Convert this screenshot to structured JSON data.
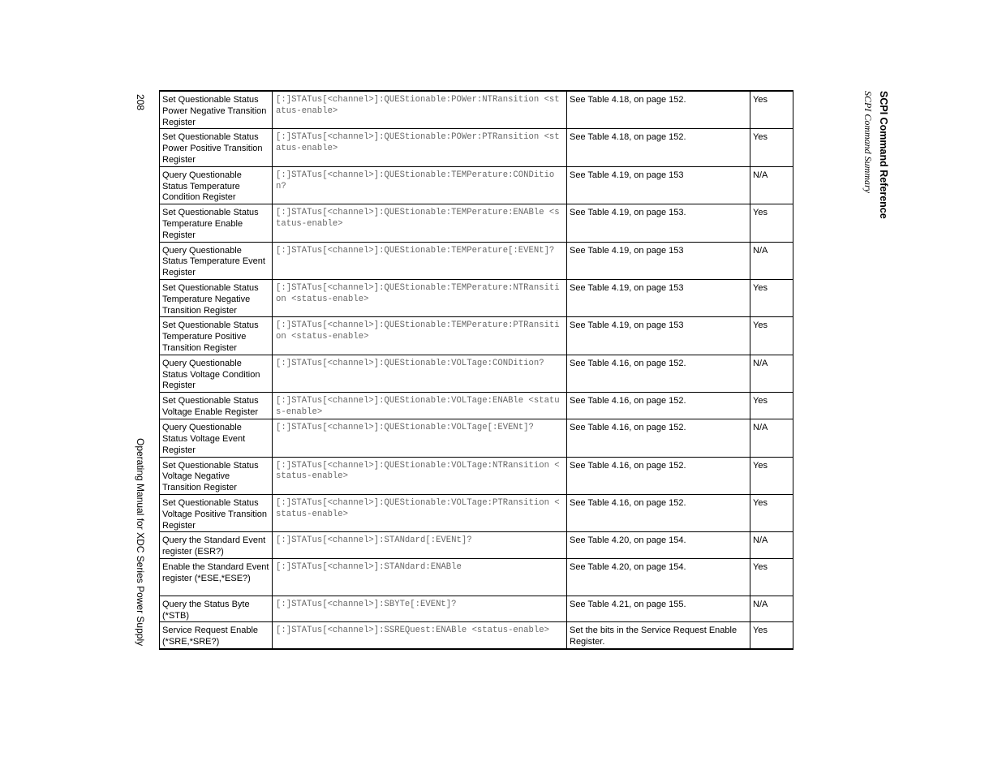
{
  "page_number": "208",
  "footer": "Operating Manual for XDC Series Power Supply",
  "header": {
    "title": "SCPI Command Reference",
    "subtitle": "SCPI Command Summary"
  },
  "rows": [
    {
      "function": "Set Questionable Status Power Negative Transition Register",
      "command": "[:]STATus[<channel>]:QUEStionable:POWer:NTRansition <status-enable>",
      "description": "See Table 4.18, on page 152.",
      "flag": "Yes"
    },
    {
      "function": "Set Questionable Status Power Positive Transition Register",
      "command": "[:]STATus[<channel>]:QUEStionable:POWer:PTRansition <status-enable>",
      "description": "See Table 4.18, on page 152.",
      "flag": "Yes"
    },
    {
      "function": "Query Questionable Status Temperature Condition Register",
      "command": "[:]STATus[<channel>]:QUEStionable:TEMPerature:CONDition?",
      "description": "See Table 4.19, on page 153",
      "flag": "N/A"
    },
    {
      "function": "Set Questionable Status Temperature Enable Register",
      "command": "[:]STATus[<channel>]:QUEStionable:TEMPerature:ENABle <status-enable>",
      "description": "See Table 4.19, on page 153.",
      "flag": "Yes"
    },
    {
      "function": "Query Questionable Status Temperature Event Register",
      "command": "[:]STATus[<channel>]:QUEStionable:TEMPerature[:EVENt]?",
      "description": "See Table 4.19, on page 153",
      "flag": "N/A"
    },
    {
      "function": "Set Questionable Status Temperature Negative Transition Register",
      "command": "[:]STATus[<channel>]:QUEStionable:TEMPerature:NTRansition <status-enable>",
      "description": "See Table 4.19, on page 153",
      "flag": "Yes"
    },
    {
      "function": "Set Questionable Status Temperature Positive Transition Register",
      "command": "[:]STATus[<channel>]:QUEStionable:TEMPerature:PTRansition <status-enable>",
      "description": "See Table 4.19, on page 153",
      "flag": "Yes"
    },
    {
      "function": "Query Questionable Status Voltage Condition Register",
      "command": "[:]STATus[<channel>]:QUEStionable:VOLTage:CONDition?",
      "description": "See Table 4.16, on page 152.",
      "flag": "N/A"
    },
    {
      "function": "Set Questionable Status Voltage Enable Register",
      "command": "[:]STATus[<channel>]:QUEStionable:VOLTage:ENABle <status-enable>",
      "description": "See Table 4.16, on page 152.",
      "flag": "Yes"
    },
    {
      "function": "Query Questionable Status Voltage Event Register",
      "command": "[:]STATus[<channel>]:QUEStionable:VOLTage[:EVENt]?",
      "description": "See Table 4.16, on page 152.",
      "flag": "N/A"
    },
    {
      "function": "Set Questionable Status Voltage Negative Transition Register",
      "command": "[:]STATus[<channel>]:QUEStionable:VOLTage:NTRansition <status-enable>",
      "description": "See Table 4.16, on page 152.",
      "flag": "Yes"
    },
    {
      "function": "Set Questionable Status Voltage Positive Transition Register",
      "command": "[:]STATus[<channel>]:QUEStionable:VOLTage:PTRansition <status-enable>",
      "description": "See Table 4.16, on page 152.",
      "flag": "Yes"
    },
    {
      "function": "Query the Standard Event register (ESR?)",
      "command": "[:]STATus[<channel>]:STANdard[:EVENt]?",
      "description": "See Table 4.20, on page 154.",
      "flag": "N/A"
    },
    {
      "function": "Enable the Standard Event register (*ESE,*ESE?)",
      "command": "[:]STATus[<channel>]:STANdard:ENABle",
      "description": "See Table 4.20, on page 154.",
      "flag": "Yes"
    },
    {
      "function": "Query the Status Byte (*STB)",
      "command": "[:]STATus[<channel>]:SBYTe[:EVENt]?",
      "description": "See Table 4.21, on page 155.",
      "flag": "N/A"
    },
    {
      "function": "Service Request Enable (*SRE,*SRE?)",
      "command": "[:]STATus[<channel>]:SSREQuest:ENABle <status-enable>",
      "description": "Set the bits in the Service Request Enable Register.",
      "flag": "Yes"
    }
  ]
}
